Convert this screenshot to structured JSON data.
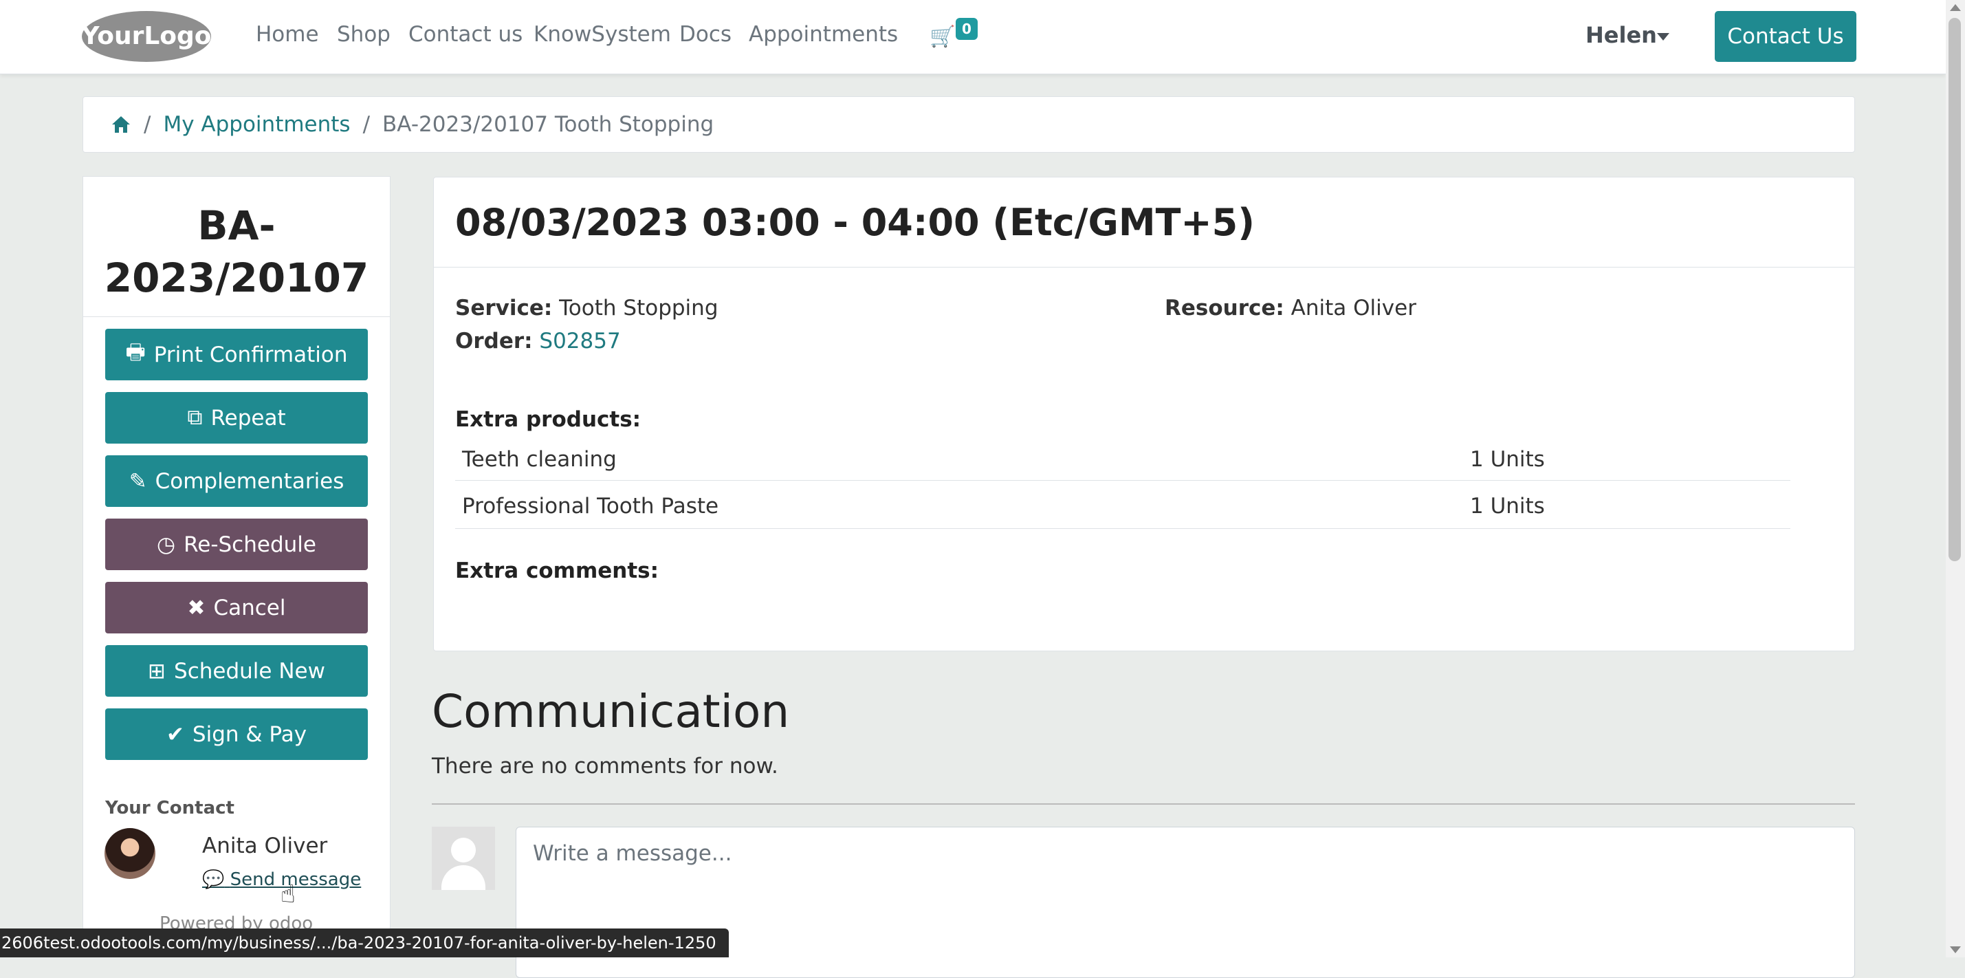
{
  "header": {
    "logo_text": "YourLogo",
    "nav": [
      "Home",
      "Shop",
      "Contact us",
      "KnowSystem",
      "Docs",
      "Appointments"
    ],
    "cart_icon": "shopping-cart-icon",
    "cart_count": "0",
    "user_name": "Helen",
    "contact_button": "Contact Us"
  },
  "breadcrumb": {
    "home_icon": "home-icon",
    "my_appointments": "My Appointments",
    "current": "BA-2023/20107 Tooth Stopping"
  },
  "sidebar": {
    "reference_line1": "BA-",
    "reference_line2": "2023/20107",
    "buttons": [
      {
        "label": "Print Confirmation",
        "icon": "print-icon",
        "glyph": "🖶",
        "style": "teal"
      },
      {
        "label": "Repeat",
        "icon": "copy-icon",
        "glyph": "⧉",
        "style": "teal"
      },
      {
        "label": "Complementaries",
        "icon": "edit-icon",
        "glyph": "✎",
        "style": "teal"
      },
      {
        "label": "Re-Schedule",
        "icon": "clock-icon",
        "glyph": "◷",
        "style": "purple"
      },
      {
        "label": "Cancel",
        "icon": "close-icon",
        "glyph": "✖",
        "style": "purple"
      },
      {
        "label": "Schedule New",
        "icon": "plus-square-icon",
        "glyph": "⊞",
        "style": "teal"
      },
      {
        "label": "Sign & Pay",
        "icon": "check-icon",
        "glyph": "✔",
        "style": "teal"
      }
    ],
    "your_contact_label": "Your Contact",
    "contact_name": "Anita Oliver",
    "send_message": "Send message",
    "powered_by": "Powered by odoo"
  },
  "appointment": {
    "time": "08/03/2023 03:00 - 04:00 (Etc/GMT+5)",
    "service_label": "Service:",
    "service_value": "Tooth Stopping",
    "resource_label": "Resource:",
    "resource_value": "Anita Oliver",
    "order_label": "Order:",
    "order_value": "S02857",
    "extra_products_label": "Extra products:",
    "extra_products": [
      {
        "name": "Teeth cleaning",
        "qty": "1 Units"
      },
      {
        "name": "Professional Tooth Paste",
        "qty": "1 Units"
      }
    ],
    "extra_comments_label": "Extra comments:"
  },
  "communication": {
    "title": "Communication",
    "empty_text": "There are no comments for now.",
    "message_placeholder": "Write a message..."
  },
  "status_bar": {
    "url": "2606test.odootools.com/my/business/.../ba-2023-20107-for-anita-oliver-by-helen-1250"
  },
  "colors": {
    "teal": "#1f8a90",
    "purple": "#6a4f63",
    "link": "#1f7a80",
    "page_bg": "#e9ecea"
  }
}
